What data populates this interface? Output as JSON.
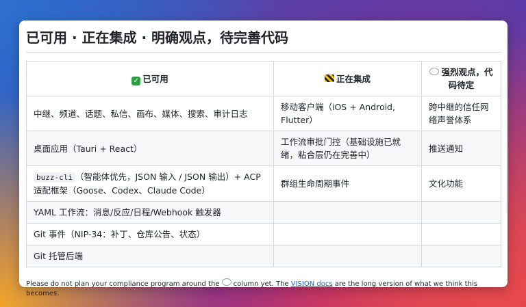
{
  "title": "已可用 · 正在集成 · 明确观点，待完善代码",
  "table": {
    "headers": [
      "已可用",
      "正在集成",
      "强烈观点，代码待定"
    ],
    "rows": [
      {
        "c1": "中继、频道、话题、私信、画布、媒体、搜索、审计日志",
        "c2": "移动客户端（iOS + Android, Flutter）",
        "c3": "跨中继的信任网络声誉体系"
      },
      {
        "c1": "桌面应用（Tauri + React）",
        "c2": "工作流审批门控（基础设施已就绪，粘合层仍在完善中）",
        "c3": "推送通知"
      },
      {
        "c1_code": "buzz-cli",
        "c1": "（智能体优先，JSON 输入 / JSON 输出）+ ACP 适配框架（Goose、Codex、Claude Code）",
        "c2": "群组生命周期事件",
        "c3": "文化功能"
      },
      {
        "c1": "YAML 工作流：消息/反应/日程/Webhook 触发器",
        "c2": "",
        "c3": ""
      },
      {
        "c1": "Git 事件（NIP-34：补丁、仓库公告、状态）",
        "c2": "",
        "c3": ""
      },
      {
        "c1": "Git 托管后端",
        "c2": "",
        "c3": ""
      }
    ]
  },
  "footnote": {
    "before": "Please do not plan your compliance program around the",
    "middle": "column yet. The",
    "link": "VISION docs",
    "after": "are the long version of what we think this becomes."
  },
  "icons": {
    "col1": "check-mark-icon",
    "col2": "construction-icon",
    "col3": "thought-bubble-icon"
  },
  "colors": {
    "link": "#0969da",
    "check": "#2ea043"
  }
}
